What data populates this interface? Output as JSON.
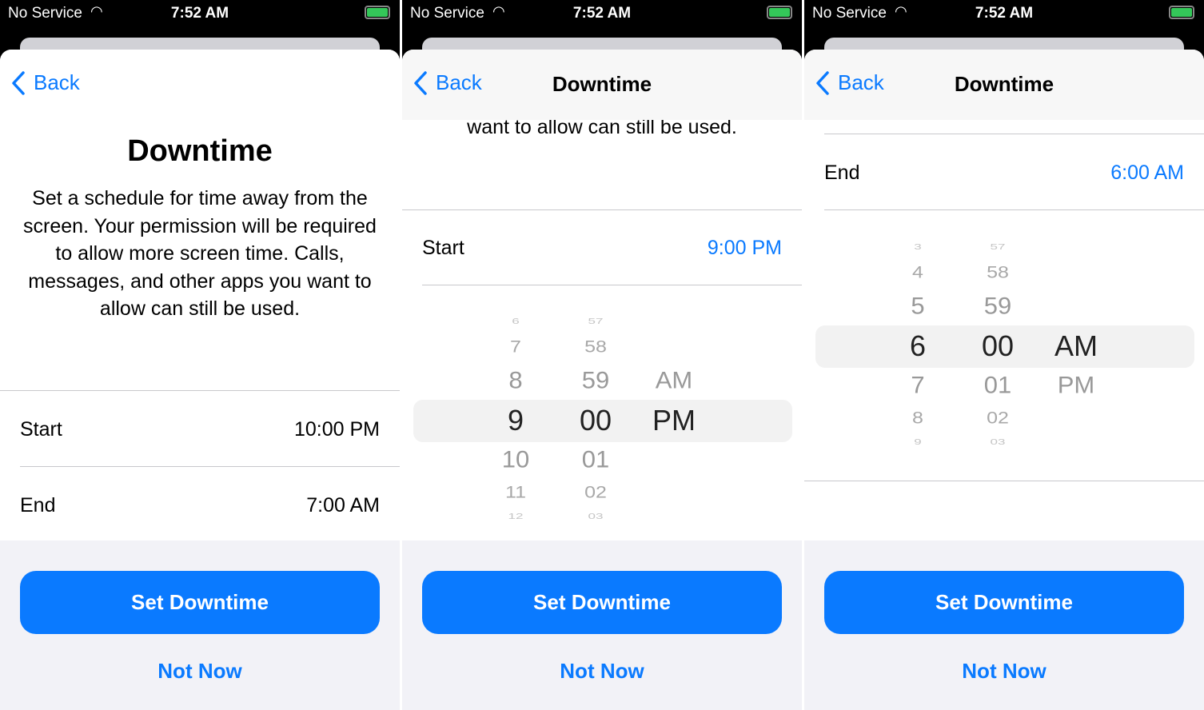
{
  "status_bar": {
    "carrier": "No Service",
    "time": "7:52 AM",
    "wifi_icon": "wifi-icon",
    "battery_icon": "battery-charging-icon",
    "battery_color": "#34c759"
  },
  "accent_color": "#0a7aff",
  "screens": [
    {
      "back_label": "Back",
      "title": "Downtime",
      "description": "Set a schedule for time away from the screen. Your permission will be required to allow more screen time. Calls, messages, and other apps you want to allow can still be used.",
      "start_label": "Start",
      "start_value": "10:00 PM",
      "end_label": "End",
      "end_value": "7:00 AM",
      "primary_button": "Set Downtime",
      "secondary_button": "Not Now"
    },
    {
      "back_label": "Back",
      "nav_title": "Downtime",
      "description_tail": "want to allow can still be used.",
      "start_label": "Start",
      "start_value": "9:00 PM",
      "picker": {
        "hours": [
          "6",
          "7",
          "8",
          "9",
          "10",
          "11",
          "12"
        ],
        "minutes": [
          "57",
          "58",
          "59",
          "00",
          "01",
          "02",
          "03"
        ],
        "am": "AM",
        "pm": "PM",
        "selected": "9:00 PM"
      },
      "primary_button": "Set Downtime",
      "secondary_button": "Not Now"
    },
    {
      "back_label": "Back",
      "nav_title": "Downtime",
      "end_label": "End",
      "end_value": "6:00 AM",
      "picker": {
        "hours": [
          "3",
          "4",
          "5",
          "6",
          "7",
          "8",
          "9"
        ],
        "minutes": [
          "57",
          "58",
          "59",
          "00",
          "01",
          "02",
          "03"
        ],
        "am": "AM",
        "pm": "PM",
        "selected": "6:00 AM"
      },
      "primary_button": "Set Downtime",
      "secondary_button": "Not Now"
    }
  ]
}
